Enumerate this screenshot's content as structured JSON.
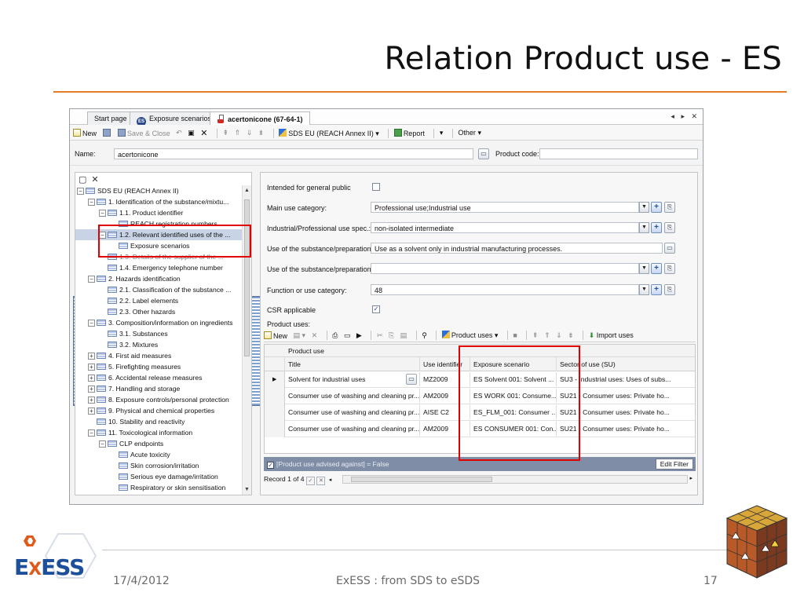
{
  "slide": {
    "title": "Relation Product use - ES",
    "footer_date": "17/4/2012",
    "footer_center": "ExESS : from SDS to eSDS",
    "page_number": "17",
    "logo_text_left": "E",
    "logo_text_x": "X",
    "logo_text_right": "ESS",
    "accent_color": "#e47b28"
  },
  "tabs": [
    {
      "label": "Start page"
    },
    {
      "label": "Exposure scenarios",
      "badge": "ES"
    },
    {
      "label": "acertonicone (67-64-1)"
    }
  ],
  "window_controls": "◂ ▸ ✕",
  "toolbar": {
    "new_label": "New",
    "save_close_label": "Save & Close",
    "sds_label": "SDS EU (REACH Annex II)",
    "report_label": "Report",
    "other_label": "Other"
  },
  "header": {
    "name_label": "Name:",
    "name_value": "acertonicone",
    "product_code_label": "Product code:",
    "product_code_value": ""
  },
  "tree": {
    "items": [
      {
        "label": "SDS EU (REACH Annex II)",
        "level": 0,
        "exp": "−"
      },
      {
        "label": "1. Identification of the substance/mixtu...",
        "level": 1,
        "exp": "−"
      },
      {
        "label": "1.1. Product identifier",
        "level": 2,
        "exp": "−"
      },
      {
        "label": "REACH registration numbers",
        "level": 3,
        "exp": ""
      },
      {
        "label": "1.2. Relevant identified uses of the ...",
        "level": 2,
        "exp": "−",
        "selected": true
      },
      {
        "label": "Exposure scenarios",
        "level": 3,
        "exp": ""
      },
      {
        "label": "1.3. Details of the supplier of the ...",
        "level": 2,
        "exp": "",
        "faded": true
      },
      {
        "label": "1.4. Emergency telephone number",
        "level": 2,
        "exp": ""
      },
      {
        "label": "2. Hazards identification",
        "level": 1,
        "exp": "−"
      },
      {
        "label": "2.1. Classification of the substance ...",
        "level": 2,
        "exp": ""
      },
      {
        "label": "2.2. Label elements",
        "level": 2,
        "exp": ""
      },
      {
        "label": "2.3. Other hazards",
        "level": 2,
        "exp": ""
      },
      {
        "label": "3. Composition/information on ingredients",
        "level": 1,
        "exp": "−"
      },
      {
        "label": "3.1. Substances",
        "level": 2,
        "exp": ""
      },
      {
        "label": "3.2. Mixtures",
        "level": 2,
        "exp": ""
      },
      {
        "label": "4. First aid measures",
        "level": 1,
        "exp": "+"
      },
      {
        "label": "5. Firefighting measures",
        "level": 1,
        "exp": "+"
      },
      {
        "label": "6. Accidental release measures",
        "level": 1,
        "exp": "+"
      },
      {
        "label": "7. Handling and storage",
        "level": 1,
        "exp": "+"
      },
      {
        "label": "8. Exposure controls/personal protection",
        "level": 1,
        "exp": "+"
      },
      {
        "label": "9. Physical and chemical properties",
        "level": 1,
        "exp": "+"
      },
      {
        "label": "10. Stability and reactivity",
        "level": 1,
        "exp": ""
      },
      {
        "label": "11. Toxicological information",
        "level": 1,
        "exp": "−"
      },
      {
        "label": "CLP endpoints",
        "level": 2,
        "exp": "−"
      },
      {
        "label": "Acute toxicity",
        "level": 3,
        "exp": ""
      },
      {
        "label": "Skin corrosion/irritation",
        "level": 3,
        "exp": ""
      },
      {
        "label": "Serious eye damage/irritation",
        "level": 3,
        "exp": ""
      },
      {
        "label": "Respiratory or skin sensitisation",
        "level": 3,
        "exp": ""
      }
    ]
  },
  "detail": {
    "intended_public_label": "Intended for general public",
    "main_use_label": "Main use category:",
    "main_use_value": "Professional use;Industrial use",
    "ind_prof_label": "Industrial/Professional use spec.:",
    "ind_prof_value": "non-isolated intermediate",
    "use_prep1_label": "Use of the substance/preparation:",
    "use_prep1_value": "Use as a solvent only in industrial manufacturing processes.",
    "use_prep2_label": "Use of the substance/preparation:",
    "use_prep2_value": "",
    "function_label": "Function or use category:",
    "function_value": "48",
    "csr_label": "CSR applicable",
    "product_uses_label": "Product uses:"
  },
  "grid_toolbar": {
    "new_label": "New",
    "product_uses_label": "Product uses",
    "import_label": "Import uses"
  },
  "grid": {
    "group_header": "Product use",
    "columns": [
      "Title",
      "Use identifier",
      "Exposure scenario",
      "Sector of use (SU)"
    ],
    "rows": [
      [
        "Solvent for industrial uses",
        "MZ2009",
        "ES Solvent 001: Solvent ...",
        "SU3 - Industrial uses: Uses of subs..."
      ],
      [
        "Consumer use of washing and cleaning pr...",
        "AM2009",
        "ES WORK 001: Consume...",
        "SU21 - Consumer uses: Private ho..."
      ],
      [
        "Consumer use of washing and cleaning pr...",
        "AISE C2",
        "ES_FLM_001: Consumer ...",
        "SU21 - Consumer uses: Private ho..."
      ],
      [
        "Consumer use of washing and cleaning pr...",
        "AM2009",
        "ES CONSUMER 001: Con...",
        "SU21 - Consumer uses: Private ho..."
      ]
    ],
    "filter_text": "[Product use advised against] = False",
    "edit_filter_label": "Edit Filter",
    "record_text": "Record 1 of 4"
  }
}
